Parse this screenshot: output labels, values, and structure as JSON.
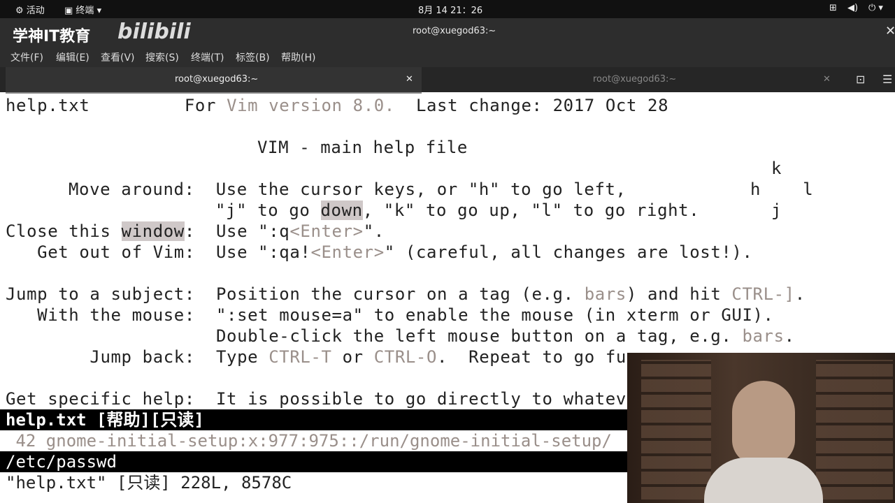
{
  "topbar": {
    "activities": "活动",
    "terminal": "终端",
    "clock": "8月 14  21：26"
  },
  "window": {
    "title": "root@xuegod63:~",
    "logo": "学神IT教育",
    "site_logo": "bilibili"
  },
  "menu": {
    "file": "文件(F)",
    "edit": "编辑(E)",
    "view": "查看(V)",
    "search": "搜索(S)",
    "terminal": "终端(T)",
    "tabs": "标签(B)",
    "help": "帮助(H)"
  },
  "tabs": [
    {
      "label": "root@xuegod63:~"
    },
    {
      "label": "root@xuegod63:~"
    }
  ],
  "vim": {
    "l1a": "help.txt",
    "l1b": "For ",
    "l1c": "Vim version 8.0.",
    "l1d": "  Last change: 2017 Oct 28",
    "l3": "VIM - main help file",
    "k": "k",
    "l5a": "Move around:  Use the cursor keys, or \"h\" to go left,",
    "hl_h": "h    l",
    "l6a": "\"j\" to go ",
    "l6b": "down",
    "l6c": ", \"k\" to go up, \"l\" to go right.",
    "j": "j",
    "l7a": "Close this ",
    "l7b": "window",
    "l7c": ":  Use \":q",
    "l7d": "<Enter>",
    "l7e": "\".",
    "l8a": "   Get out of Vim:  Use \":qa!",
    "l8b": "<Enter>",
    "l8c": "\" (careful, all changes are lost!).",
    "l10a": "Jump to a subject:  Position the cursor on a tag (e.g. ",
    "l10b": "bars",
    "l10c": ") and hit ",
    "l10d": "CTRL-]",
    "l10e": ".",
    "l11": "   With the mouse:  \":set mouse=a\" to enable the mouse (in xterm or GUI).",
    "l12a": "                    Double-click the left mouse button on a tag, e.g. ",
    "l12b": "bars",
    "l12c": ".",
    "l13a": "        Jump back:  Type ",
    "l13b": "CTRL-T",
    "l13c": " or ",
    "l13d": "CTRL-O",
    "l13e": ".  Repeat to go fu",
    "l15": "Get specific help:  It is possible to go directly to whateve",
    "status1": "help.txt [帮助][只读]",
    "passwd_line": " 42 gnome-initial-setup:x:977:975::/run/gnome-initial-setup/",
    "status2": "/etc/passwd",
    "cmdline": "\"help.txt\" [只读] 228L, 8578C"
  }
}
